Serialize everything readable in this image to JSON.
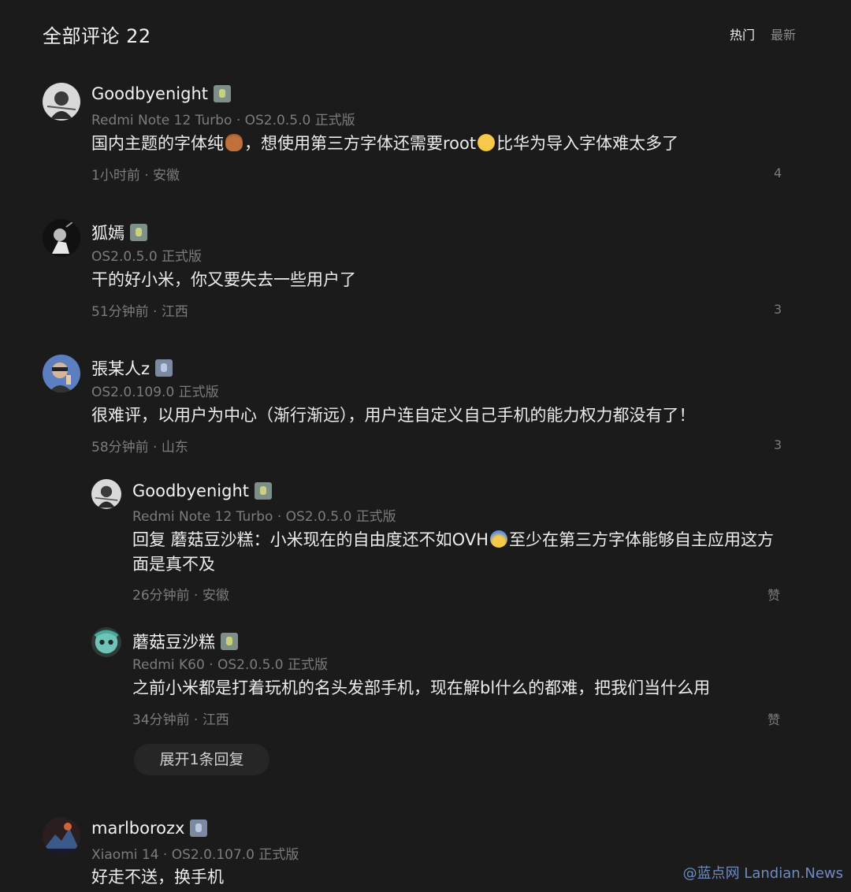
{
  "header": {
    "title": "全部评论 22",
    "tabs": [
      "热门",
      "最新"
    ]
  },
  "comments": [
    {
      "username": "Goodbyenight",
      "device": "Redmi Note 12 Turbo · OS2.0.5.0 正式版",
      "content_a": "国内主题的字体纯",
      "content_b": "，想使用第三方字体还需要root",
      "content_c": "比华为导入字体难太多了",
      "meta": "1小时前 · 安徽",
      "count": "4"
    },
    {
      "username": "狐嫣",
      "device": "OS2.0.5.0 正式版",
      "content": "干的好小米，你又要失去一些用户了",
      "meta": "51分钟前 · 江西",
      "count": "3"
    },
    {
      "username": "張某人z",
      "device": "OS2.0.109.0 正式版",
      "content": "很难评，以用户为中心（渐行渐远），用户连自定义自己手机的能力权力都没有了！",
      "meta": "58分钟前 · 山东",
      "count": "3"
    },
    {
      "username": "marlborozx",
      "device": "Xiaomi 14 · OS2.0.107.0 正式版",
      "content": "好走不送，换手机"
    }
  ],
  "replies": [
    {
      "username": "Goodbyenight",
      "device": "Redmi Note 12 Turbo · OS2.0.5.0 正式版",
      "content_line1_a": "回复 蘑菇豆沙糕：小米现在的自由度还不如OVH",
      "content_line1_b": "至少在第三方字体能够自主应用这方",
      "content_line2": "面是真不及",
      "meta": "26分钟前 · 安徽",
      "like": "赞"
    },
    {
      "username": "蘑菇豆沙糕",
      "device": "Redmi K60 · OS2.0.5.0 正式版",
      "content": "之前小米都是打着玩机的名头发部手机，现在解bl什么的都难，把我们当什么用",
      "meta": "34分钟前 · 江西",
      "like": "赞"
    }
  ],
  "expand_replies": "展开1条回复",
  "watermark": "@蓝点网 Landian.News",
  "icons": {
    "poop": "poop-emoji-icon",
    "rolleyes": "eye-roll-emoji-icon",
    "scream": "scream-emoji-icon"
  },
  "colors": {
    "background": "#1b1b1b",
    "text": "#ececec",
    "muted": "#7c7c7c"
  }
}
